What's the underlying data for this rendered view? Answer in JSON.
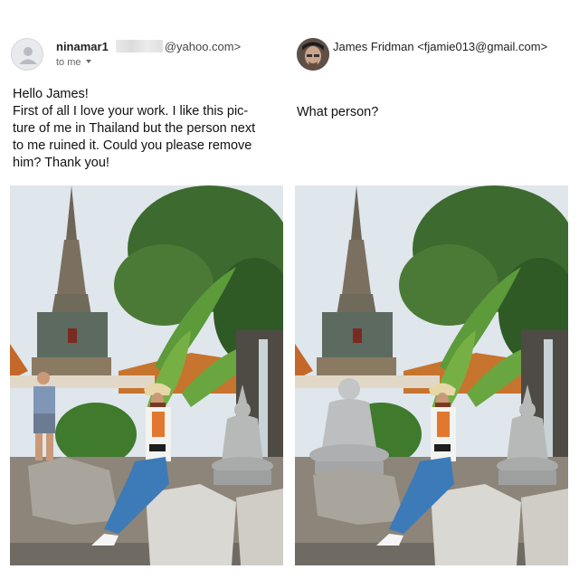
{
  "left_email": {
    "sender_name": "ninamar1",
    "sender_domain": "@yahoo.com>",
    "to_label": "to me",
    "body_lines": [
      "Hello James!",
      "First of all I love your  work. I like  this pic-",
      "ture of me in Thailand but the person next",
      "to me ruined it.  Could you please remove",
      "him? Thank you!"
    ],
    "photo_icon": "temple-photo-with-man"
  },
  "right_email": {
    "sender_name": "James Fridman",
    "sender_email": "<fjamie013@gmail.com>",
    "body": "What person?",
    "photo_icon": "temple-photo-man-replaced-by-statue"
  },
  "colors": {
    "sky": "#dfe6ec",
    "foliage": "#3d6a2e",
    "skirt": "#3d7ab8",
    "statue": "#b7b9b8"
  }
}
